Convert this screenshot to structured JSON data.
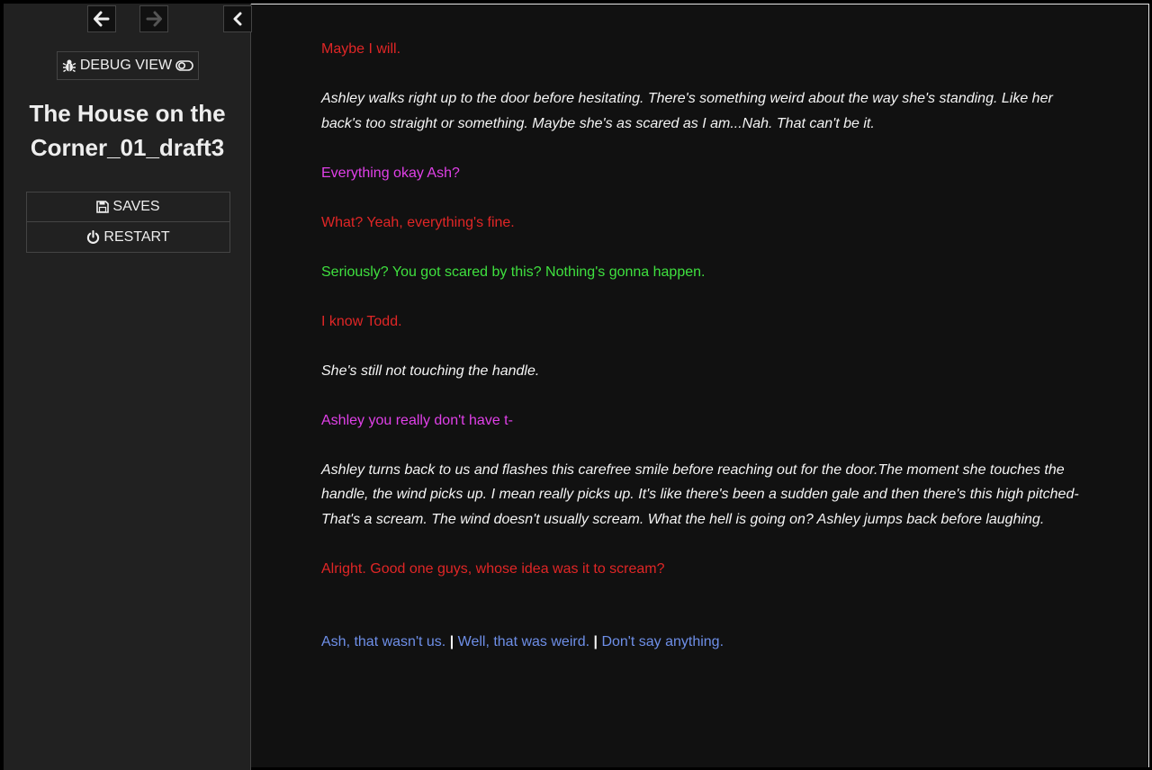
{
  "ui_bar": {
    "back_icon": "arrow-left-icon",
    "forward_icon": "arrow-right-icon",
    "collapse_icon": "chevron-left-icon",
    "debug_label": "DEBUG VIEW",
    "debug_icon": "bug-icon",
    "toggle_icon": "toggle-icon",
    "story_title": "The House on the Corner_01_draft3",
    "menu": [
      {
        "label": "SAVES",
        "icon": "floppy-disk-icon"
      },
      {
        "label": "RESTART",
        "icon": "power-icon"
      }
    ]
  },
  "passage": {
    "lines": [
      {
        "text": "Maybe I will.",
        "style": "ashley"
      },
      {
        "text": "Ashley walks right up to the door before hesitating. There's something weird about the way she's standing. Like her back's too straight or something. Maybe she's as scared as I am...Nah. That can't be it.",
        "style": "narration"
      },
      {
        "text": "Everything okay Ash?",
        "style": "magenta"
      },
      {
        "text": "What? Yeah, everything's fine.",
        "style": "ashley"
      },
      {
        "text": "Seriously? You got scared by this? Nothing's gonna happen.",
        "style": "todd"
      },
      {
        "text": "I know Todd.",
        "style": "ashley"
      },
      {
        "text": "She's still not touching the handle.",
        "style": "narration"
      },
      {
        "text": "Ashley you really don't have t-",
        "style": "magenta"
      },
      {
        "text": "Ashley turns back to us and flashes this carefree smile before reaching out for the door.The moment she touches the handle, the wind picks up. I mean really picks up. It's like there's been a sudden gale and then there's this high pitched- That's a scream. The wind doesn't usually scream. What the hell is going on? Ashley jumps back before laughing.",
        "style": "narration"
      },
      {
        "text": "Alright. Good one guys, whose idea was it to scream?",
        "style": "ashley"
      }
    ],
    "choices": [
      "Ash, that wasn't us.",
      "Well, that was weird.",
      "Don't say anything."
    ],
    "separator": "|"
  },
  "colors": {
    "ashley": "#e02626",
    "magenta": "#e040e8",
    "todd": "#3fe03f",
    "narration": "#f4f4f4",
    "link": "#6e8fe8",
    "sidebar_bg": "#212121",
    "passage_bg": "#111111"
  }
}
